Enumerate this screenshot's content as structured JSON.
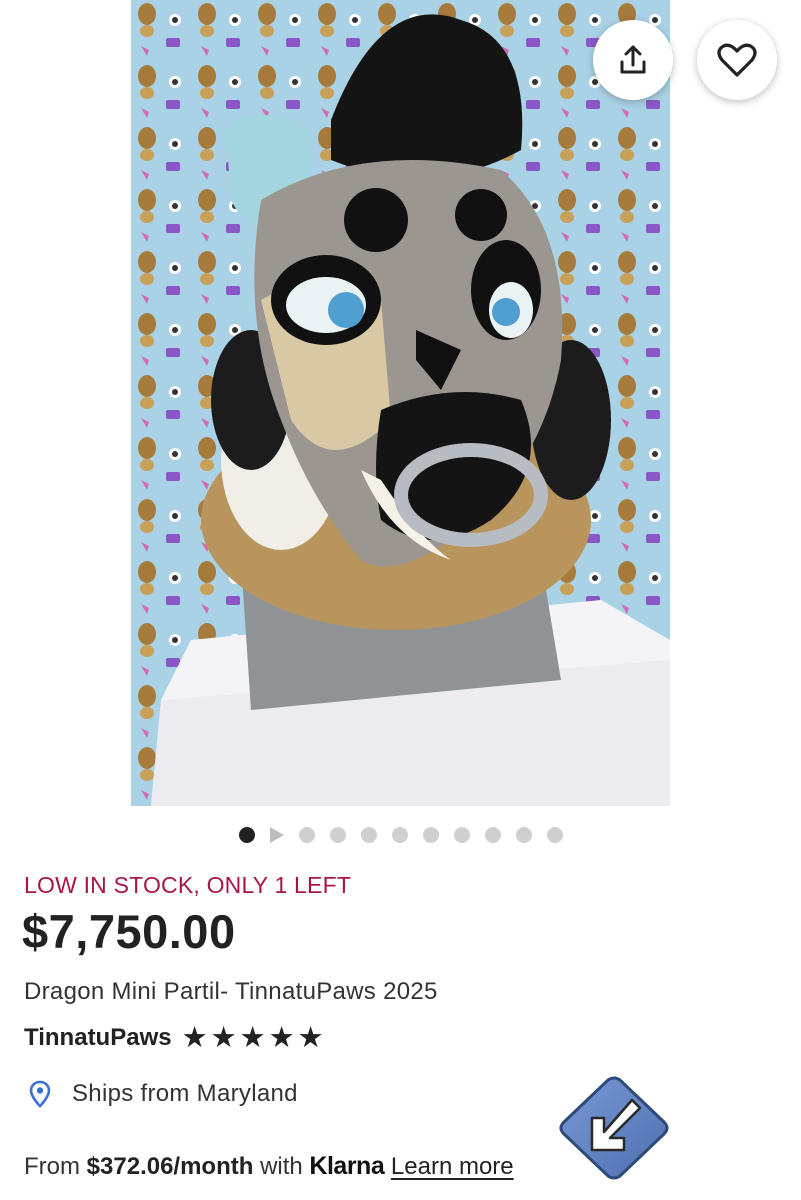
{
  "listing": {
    "stock_notice": "LOW IN STOCK, ONLY 1 LEFT",
    "price": "$7,750.00",
    "title": "Dragon Mini Partil- TinnatuPaws 2025",
    "shop_name": "TinnatuPaws",
    "rating_stars": 5,
    "ships_from": "Ships from Maryland"
  },
  "financing": {
    "prefix": "From ",
    "amount": "$372.06/month",
    "middle": " with ",
    "provider": "Klarna",
    "link": "Learn more"
  },
  "gallery": {
    "image_count": 11,
    "active_index": 0,
    "second_item_is_video": true
  },
  "icons": {
    "share": "share-icon",
    "favorite": "heart-icon",
    "location": "location-pin-icon",
    "star": "star-icon",
    "overlay": "diagonal-arrow-sticker-icon"
  },
  "colors": {
    "stock_text": "#a6164a",
    "pin": "#3b6fd1",
    "text": "#222222"
  }
}
